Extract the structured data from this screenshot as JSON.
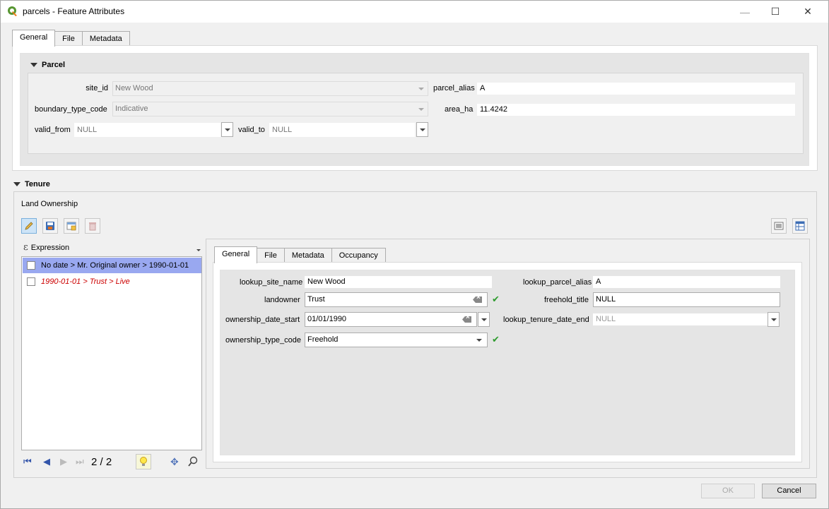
{
  "window": {
    "title": "parcels - Feature Attributes",
    "minimize": "—",
    "maximize": "☐",
    "close": "✕"
  },
  "top_tabs": [
    "General",
    "File",
    "Metadata"
  ],
  "parcel": {
    "group_title": "Parcel",
    "site_id_label": "site_id",
    "site_id_value": "New Wood",
    "parcel_alias_label": "parcel_alias",
    "parcel_alias_value": "A",
    "boundary_type_code_label": "boundary_type_code",
    "boundary_type_code_value": "Indicative",
    "area_ha_label": "area_ha",
    "area_ha_value": "11.4242",
    "valid_from_label": "valid_from",
    "valid_from_value": "NULL",
    "valid_to_label": "valid_to",
    "valid_to_value": "NULL"
  },
  "tenure": {
    "group_title": "Tenure",
    "relation_label": "Land Ownership",
    "expression_label": "Expression",
    "list_items": [
      "No date > Mr. Original owner > 1990-01-01",
      "1990-01-01 > Trust > Live"
    ],
    "counter": "2 / 2",
    "inner_tabs": [
      "General",
      "File",
      "Metadata",
      "Occupancy"
    ],
    "form": {
      "lookup_site_name_label": "lookup_site_name",
      "lookup_site_name_value": "New Wood",
      "lookup_parcel_alias_label": "lookup_parcel_alias",
      "lookup_parcel_alias_value": "A",
      "landowner_label": "landowner",
      "landowner_value": "Trust",
      "freehold_title_label": "freehold_title",
      "freehold_title_value": "NULL",
      "ownership_date_start_label": "ownership_date_start",
      "ownership_date_start_value": "01/01/1990",
      "lookup_tenure_date_end_label": "lookup_tenure_date_end",
      "lookup_tenure_date_end_value": "NULL",
      "ownership_type_code_label": "ownership_type_code",
      "ownership_type_code_value": "Freehold"
    }
  },
  "buttons": {
    "ok": "OK",
    "cancel": "Cancel"
  },
  "colors": {
    "selected_row": "#99a8f0",
    "invalid_text": "#cc0000",
    "check": "#2e9c2e",
    "qgis_green": "#589632"
  },
  "icons": [
    "qgis-logo-icon",
    "edit-pencil-icon",
    "save-icon",
    "add-feature-icon",
    "delete-feature-icon",
    "form-view-icon",
    "table-view-icon",
    "expression-icon",
    "first-icon",
    "prev-icon",
    "next-icon",
    "last-icon",
    "highlight-icon",
    "pan-icon",
    "zoom-icon",
    "check-icon",
    "clear-icon"
  ]
}
